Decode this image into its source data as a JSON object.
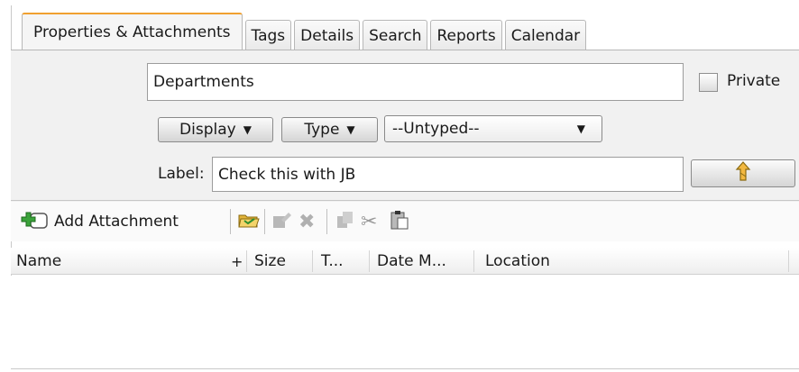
{
  "tabs": [
    {
      "label": "Properties & Attachments",
      "active": true
    },
    {
      "label": "Tags"
    },
    {
      "label": "Details"
    },
    {
      "label": "Search"
    },
    {
      "label": "Reports"
    },
    {
      "label": "Calendar"
    }
  ],
  "form": {
    "name_value": "Departments",
    "private_label": "Private",
    "private_checked": false,
    "display_label": "Display",
    "type_label": "Type",
    "type_select_value": "--Untyped--",
    "label_caption": "Label:",
    "label_value": "Check this with JB"
  },
  "toolbar": {
    "add_attachment_label": "Add Attachment",
    "icons": [
      "add-attachment-icon",
      "open-folder-icon",
      "edit-icon",
      "delete-icon",
      "copy-icon",
      "cut-icon",
      "paste-icon"
    ]
  },
  "list": {
    "columns": [
      "Name",
      "Size",
      "T...",
      "Date M...",
      "Location"
    ],
    "sort_indicator": "+",
    "rows": []
  },
  "colors": {
    "active_tab_accent": "#f0a030",
    "panel_bg": "#f1f1f1",
    "add_icon_green": "#3aa23a"
  }
}
